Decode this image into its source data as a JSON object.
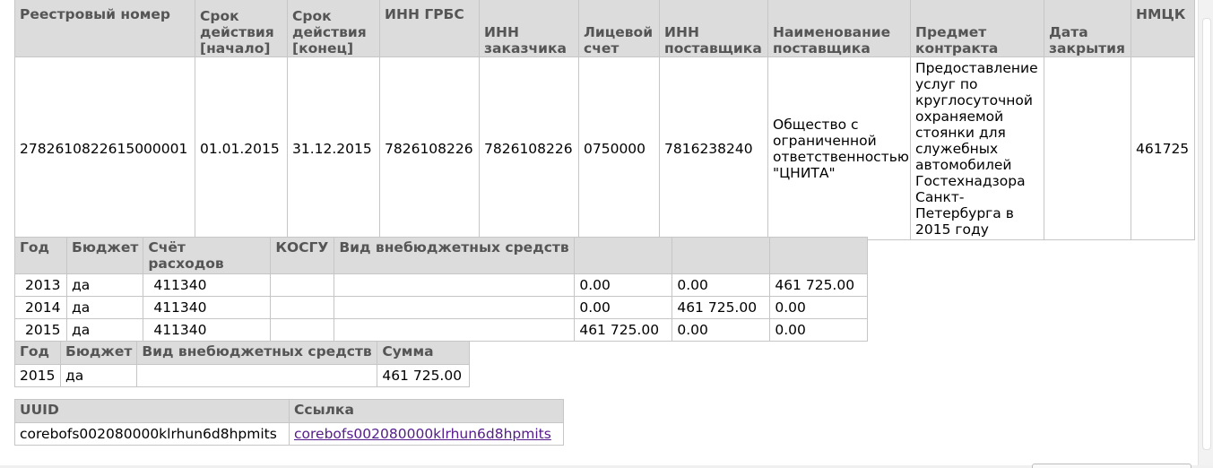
{
  "contract_table": {
    "headers": [
      "Реестровый номер",
      "Срок действия [начало]",
      "Срок действия [конец]",
      "ИНН ГРБС",
      "ИНН заказчика",
      "Лицевой счет",
      "ИНН поставщика",
      "Наименование поставщика",
      "Предмет контракта",
      "Дата закрытия",
      "НМЦК"
    ],
    "row": {
      "registry_number": "2782610822615000001",
      "start": "01.01.2015",
      "end": "31.12.2015",
      "inn_grbs": "7826108226",
      "inn_customer": "7826108226",
      "account": "0750000",
      "inn_supplier": "7816238240",
      "supplier_name": "Общество с ограниченной ответственностью \"ЦНИТА\"",
      "subject": "Предоставление услуг по круглосуточной охраняемой стоянки для служебных автомобилей Гостехнадзора Санкт-Петербурга в 2015 году",
      "close_date": "",
      "nmck": "461725"
    }
  },
  "budget_table": {
    "headers": [
      "Год",
      "Бюджет",
      "Счёт расходов",
      "КОСГУ",
      "Вид внебюджетных средств",
      "",
      "",
      ""
    ],
    "rows": [
      [
        "2013",
        "да",
        "411340",
        "",
        "",
        "0.00",
        "0.00",
        "461 725.00"
      ],
      [
        "2014",
        "да",
        "411340",
        "",
        "",
        "0.00",
        "461 725.00",
        "0.00"
      ],
      [
        "2015",
        "да",
        "411340",
        "",
        "",
        "461 725.00",
        "0.00",
        "0.00"
      ]
    ]
  },
  "sum_table": {
    "headers": [
      "Год",
      "Бюджет",
      "Вид внебюджетных средств",
      "Сумма"
    ],
    "rows": [
      [
        "2015",
        "да",
        "",
        "461 725.00"
      ]
    ]
  },
  "uuid_table": {
    "headers": [
      "UUID",
      "Ссылка"
    ],
    "uuid": "corebofs002080000klrhun6d8hpmits",
    "link": "corebofs002080000klrhun6d8hpmits"
  }
}
